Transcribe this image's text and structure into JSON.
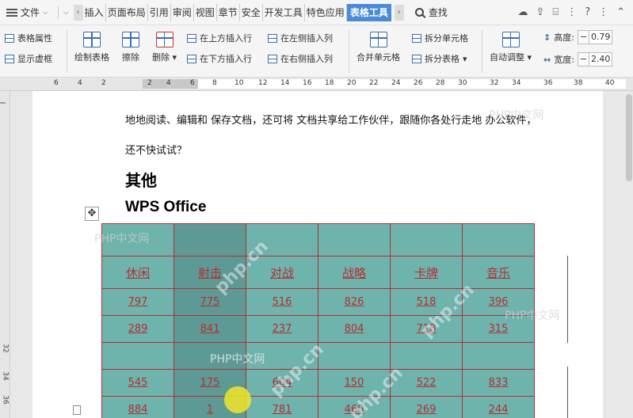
{
  "menubar": {
    "file": "文件",
    "tabs": [
      "插入",
      "页面布局",
      "引用",
      "审阅",
      "视图",
      "章节",
      "安全",
      "开发工具",
      "特色应用"
    ],
    "active_tab": "表格工具",
    "search": "查找"
  },
  "ribbon": {
    "table_props": "表格属性",
    "show_gridlines": "显示虚框",
    "draw_table": "绘制表格",
    "erase": "擦除",
    "delete": "删除",
    "insert_above": "在上方插入行",
    "insert_below": "在下方插入行",
    "insert_left": "在左侧插入列",
    "insert_right": "在右侧插入列",
    "merge_cells": "合并单元格",
    "split_cells": "拆分单元格",
    "split_table": "拆分表格",
    "auto_fit": "自动调整",
    "height_label": "高度:",
    "height_value": "0.79",
    "width_label": "宽度:",
    "width_value": "2.40"
  },
  "ruler": {
    "ticks": [
      "6",
      "4",
      "2",
      "2",
      "4",
      "6",
      "8",
      "10",
      "12",
      "14",
      "16",
      "18",
      "20",
      "22",
      "24",
      "26",
      "28",
      "30",
      "32",
      "34",
      "36",
      "38",
      "40"
    ]
  },
  "document": {
    "para1": "地地阅读、编辑和 保存文档，还可将 文档共享给工作伙伴，跟随你各处行走地 办公软件，",
    "para2": "还不快试试？",
    "heading1": "其他",
    "heading2": "WPS Office"
  },
  "table": {
    "rows": [
      [
        "",
        "",
        "",
        "",
        "",
        ""
      ],
      [
        "休闲",
        "射击",
        "对战",
        "战略",
        "卡牌",
        "音乐"
      ],
      [
        "797",
        "775",
        "516",
        "826",
        "518",
        "396"
      ],
      [
        "289",
        "841",
        "237",
        "804",
        "718",
        "315"
      ],
      [
        "",
        "",
        "",
        "",
        "",
        ""
      ],
      [
        "545",
        "175",
        "604",
        "150",
        "522",
        "833"
      ],
      [
        "884",
        "1",
        "781",
        "460",
        "269",
        "244"
      ]
    ]
  },
  "watermark": "PHP中文网",
  "watermark_domain": "php.cn",
  "colors": {
    "cell_bg": "#6fb3ad",
    "selected_col_bg": "#5e9a95",
    "cell_border": "#b03030",
    "active_tab": "#4a8bd6"
  }
}
